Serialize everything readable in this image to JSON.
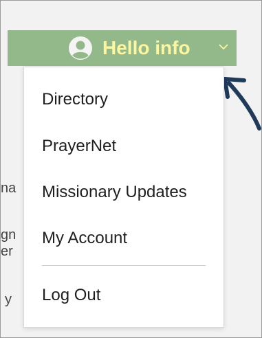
{
  "header": {
    "greeting": "Hello info",
    "avatar_icon": "user-avatar-icon",
    "dropdown_icon": "chevron-down-icon",
    "bar_color": "#93b98a",
    "greeting_color": "#fdf6a0"
  },
  "background_fragments": [
    "na",
    "gn",
    "er",
    "y"
  ],
  "menu": {
    "items": [
      {
        "label": "Directory"
      },
      {
        "label": "PrayerNet"
      },
      {
        "label": "Missionary Updates"
      },
      {
        "label": "My Account"
      }
    ],
    "logout_label": "Log Out"
  },
  "annotation": {
    "icon": "arrow-annotation-icon",
    "color": "#1f3a5a"
  }
}
